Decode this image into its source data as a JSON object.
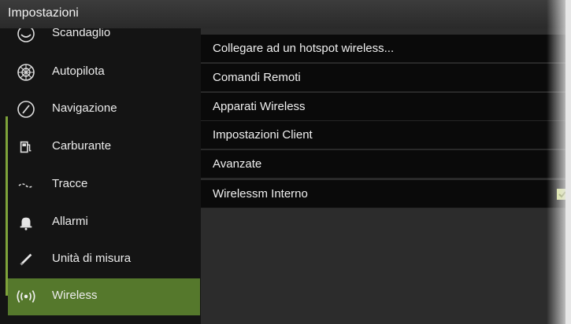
{
  "window": {
    "title": "Impostazioni"
  },
  "sidebar": {
    "items": [
      {
        "label": "Scandaglio",
        "icon": "sonar-icon"
      },
      {
        "label": "Autopilota",
        "icon": "steering-wheel-icon"
      },
      {
        "label": "Navigazione",
        "icon": "compass-icon"
      },
      {
        "label": "Carburante",
        "icon": "fuel-pump-icon"
      },
      {
        "label": "Tracce",
        "icon": "track-icon"
      },
      {
        "label": "Allarmi",
        "icon": "bell-icon"
      },
      {
        "label": "Unità di misura",
        "icon": "ruler-icon"
      },
      {
        "label": "Wireless",
        "icon": "wireless-icon",
        "selected": true
      }
    ]
  },
  "content": {
    "options": [
      {
        "label": "Collegare ad un hotspot wireless..."
      },
      {
        "label": "Comandi Remoti"
      },
      {
        "label": "Apparati Wireless"
      },
      {
        "label": "Impostazioni Client"
      },
      {
        "label": "Avanzate"
      },
      {
        "label": "Wirelessm Interno",
        "checked": true
      }
    ]
  },
  "colors": {
    "accent": "#55782c",
    "scrollbar": "#7ea33a",
    "checkbox": "#d6e38a"
  }
}
